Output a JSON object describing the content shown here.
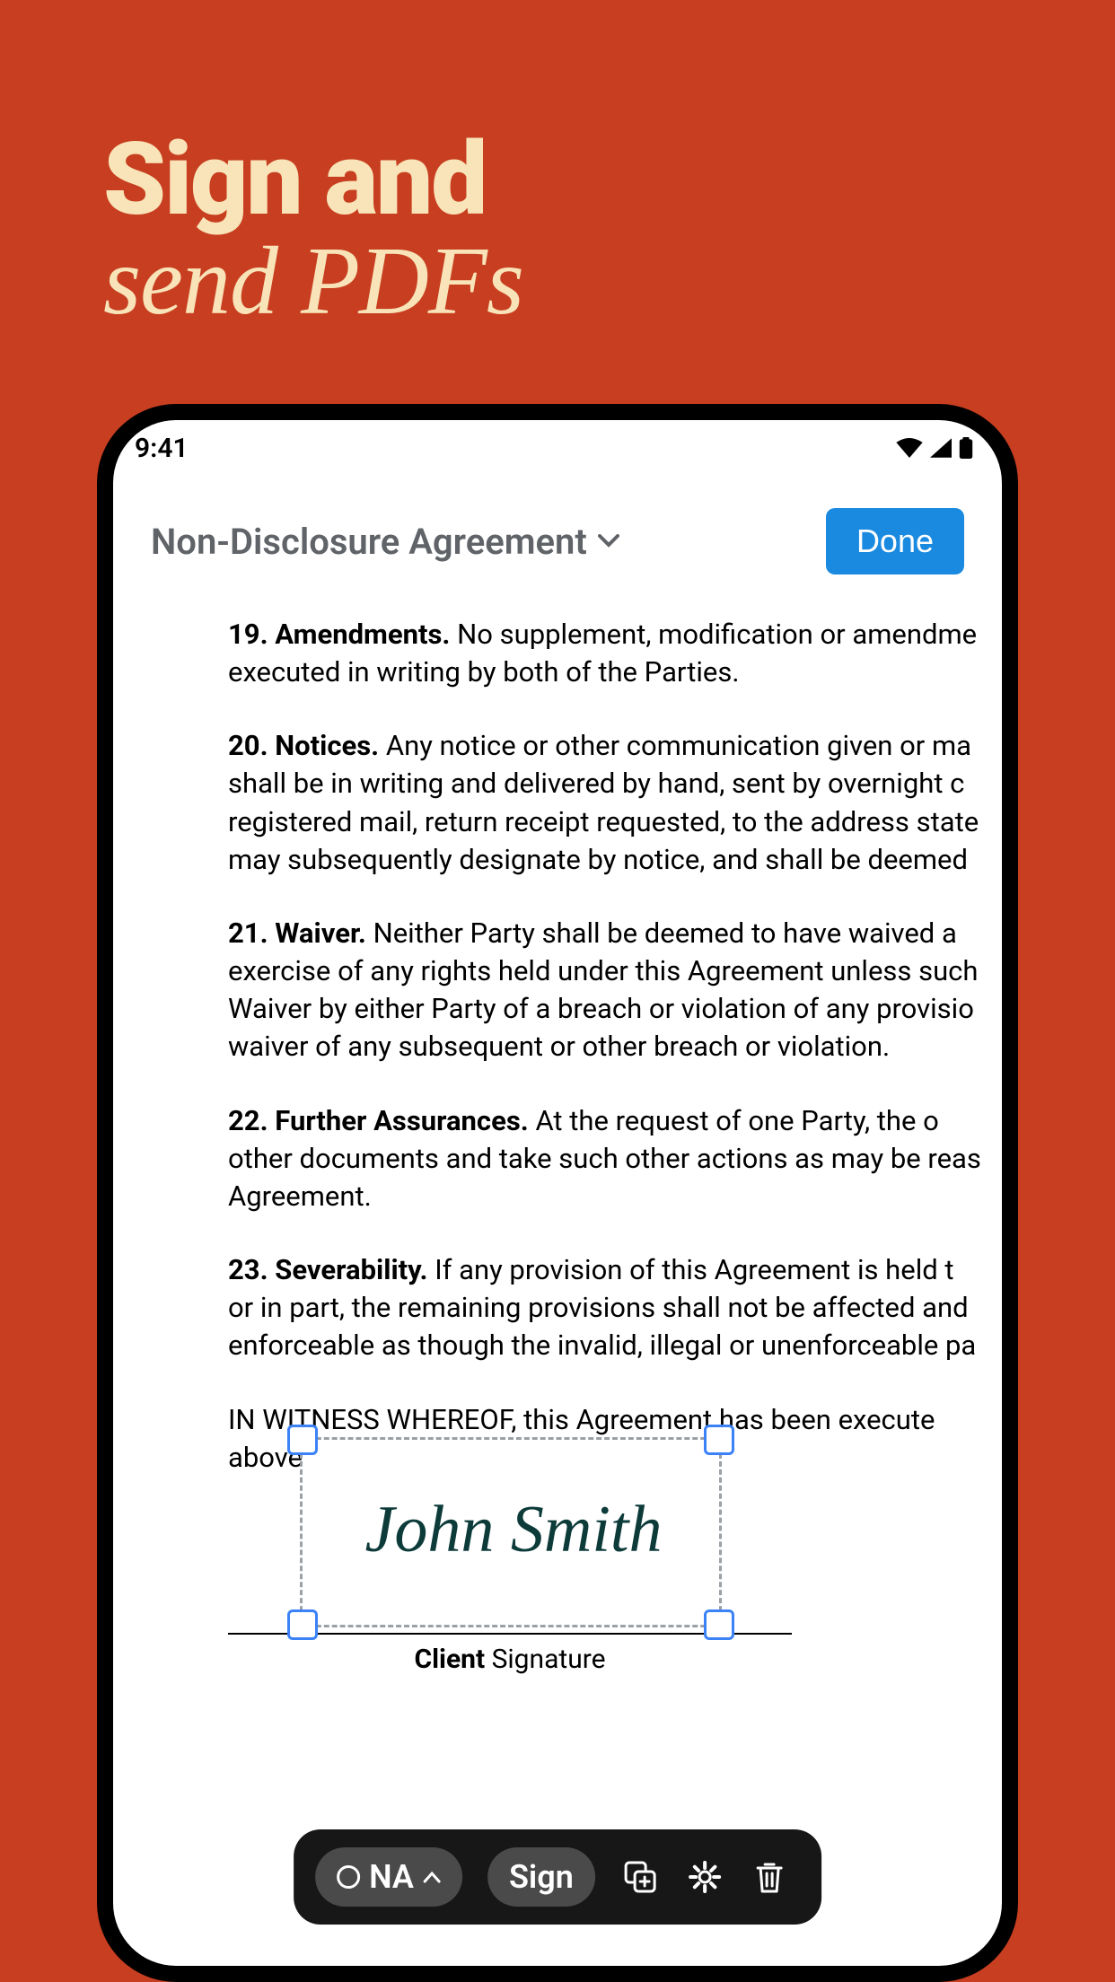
{
  "marketing": {
    "line1": "Sign and",
    "line2": "send PDFs"
  },
  "statusBar": {
    "time": "9:41"
  },
  "header": {
    "title": "Non-Disclosure Agreement",
    "doneLabel": "Done"
  },
  "document": {
    "sections": [
      {
        "num": "19.",
        "title": "Amendments.",
        "body": "No supplement, modification or amendme",
        "body2": "executed in writing by both of the Parties."
      },
      {
        "num": "20.",
        "title": "Notices.",
        "body": " Any notice or other communication given or ma",
        "body2": "shall be in writing and delivered by hand, sent by overnight c",
        "body3": "registered mail, return receipt requested, to the address state",
        "body4": "may subsequently designate by notice, and shall be deemed"
      },
      {
        "num": "21.",
        "title": "Waiver.",
        "body": " Neither Party shall be deemed to have waived a",
        "body2": "exercise of any rights held under this Agreement unless such",
        "body3": "Waiver by either Party of a breach or violation of any provisio",
        "body4": "waiver of any subsequent or other breach or violation."
      },
      {
        "num": "22.",
        "title": "Further Assurances.",
        "body": " At the request of one Party, the o",
        "body2": "other documents and take such other actions as may be reas",
        "body3": "Agreement."
      },
      {
        "num": "23.",
        "title": "Severability.",
        "body": " If any provision of this Agreement is held t",
        "body2": "or in part, the remaining provisions shall not be affected and",
        "body3": "enforceable as though the invalid, illegal or unenforceable pa"
      }
    ],
    "witness": "IN WITNESS WHEREOF, this Agreement has been execute",
    "witness2": "above"
  },
  "signature": {
    "name": "John Smith",
    "labelBold": "Client",
    "labelRest": " Signature"
  },
  "toolbar": {
    "pill1": "NA",
    "pill2": "Sign"
  }
}
